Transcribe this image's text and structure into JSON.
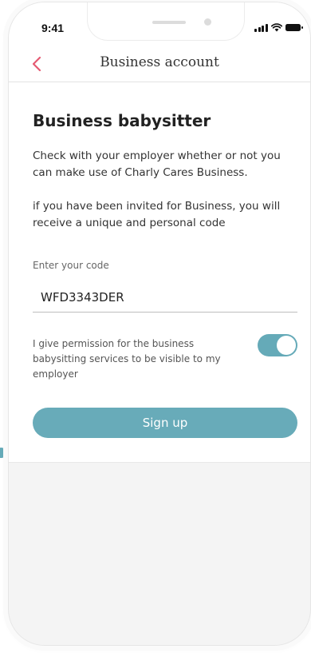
{
  "status_bar": {
    "time": "9:41",
    "icons": [
      "signal-icon",
      "wifi-icon",
      "battery-icon"
    ]
  },
  "nav": {
    "back_icon": "chevron-left-icon",
    "title": "Business account"
  },
  "content": {
    "heading": "Business babysitter",
    "paragraph_1": "Check with your employer whether or not you can make use of Charly Cares Business.",
    "paragraph_2": "if you have been invited for Business, you will receive a unique and personal code"
  },
  "code_field": {
    "label": "Enter your code",
    "value": "WFD3343DER"
  },
  "permission": {
    "text": "I give permission for the business babysitting services to be visible to my employer",
    "enabled": true
  },
  "actions": {
    "signup_label": "Sign up"
  },
  "colors": {
    "accent": "#68abb9",
    "back_arrow": "#e55a72",
    "text": "#333333"
  }
}
